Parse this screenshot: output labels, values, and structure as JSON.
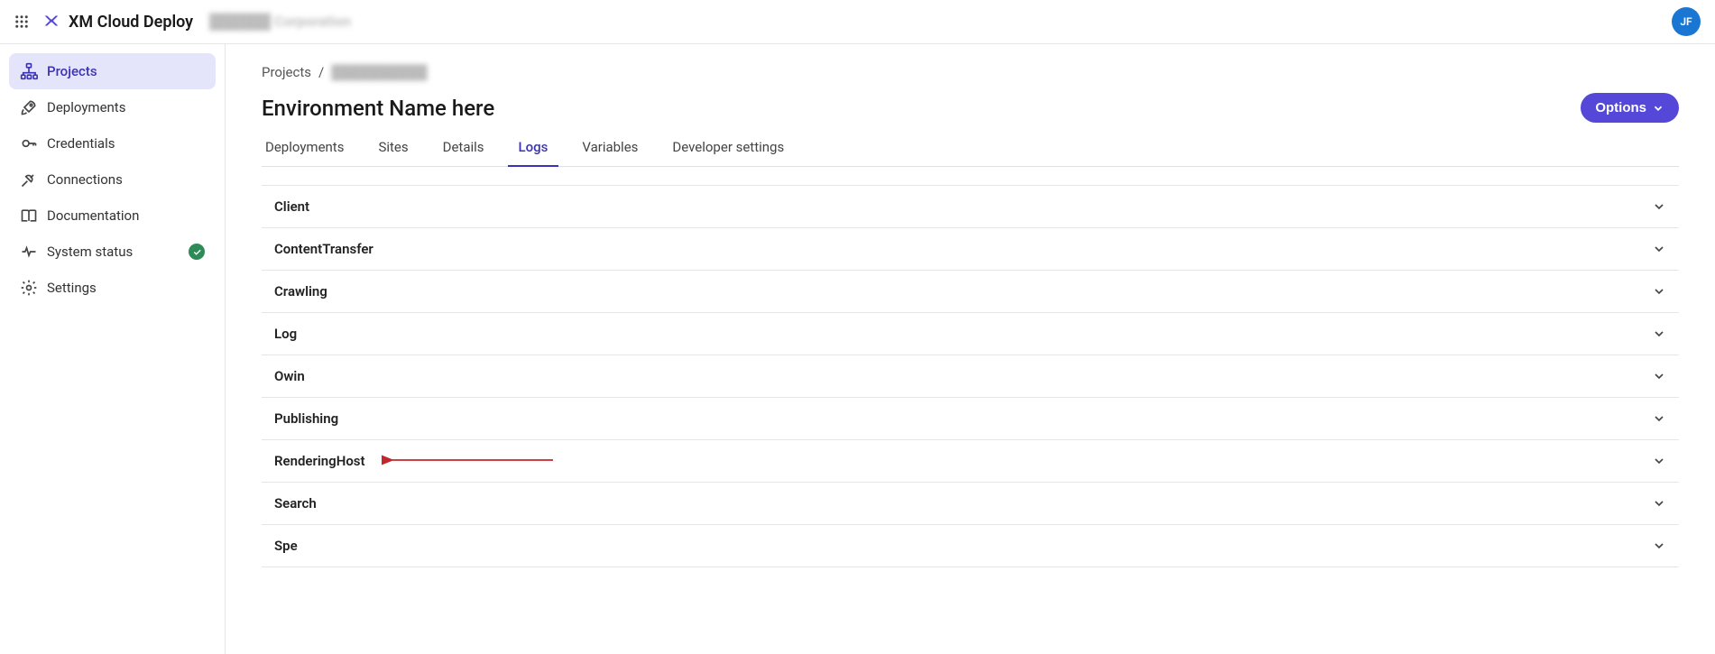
{
  "header": {
    "product_name": "XM Cloud Deploy",
    "org_name": "██████ Corporation",
    "avatar_initials": "JF"
  },
  "sidebar": {
    "items": [
      {
        "label": "Projects",
        "active": true
      },
      {
        "label": "Deployments"
      },
      {
        "label": "Credentials"
      },
      {
        "label": "Connections"
      },
      {
        "label": "Documentation"
      },
      {
        "label": "System status",
        "status_ok": true
      },
      {
        "label": "Settings"
      }
    ]
  },
  "breadcrumb": {
    "root": "Projects",
    "sep": "/",
    "current": "██████████"
  },
  "page_title": "Environment Name here",
  "options_label": "Options",
  "tabs": [
    {
      "label": "Deployments"
    },
    {
      "label": "Sites"
    },
    {
      "label": "Details"
    },
    {
      "label": "Logs",
      "active": true
    },
    {
      "label": "Variables"
    },
    {
      "label": "Developer settings"
    }
  ],
  "log_categories": [
    {
      "label": "Client"
    },
    {
      "label": "ContentTransfer"
    },
    {
      "label": "Crawling"
    },
    {
      "label": "Log"
    },
    {
      "label": "Owin"
    },
    {
      "label": "Publishing"
    },
    {
      "label": "RenderingHost",
      "annotated": true
    },
    {
      "label": "Search"
    },
    {
      "label": "Spe"
    }
  ],
  "annotation_color": "#c1272d"
}
